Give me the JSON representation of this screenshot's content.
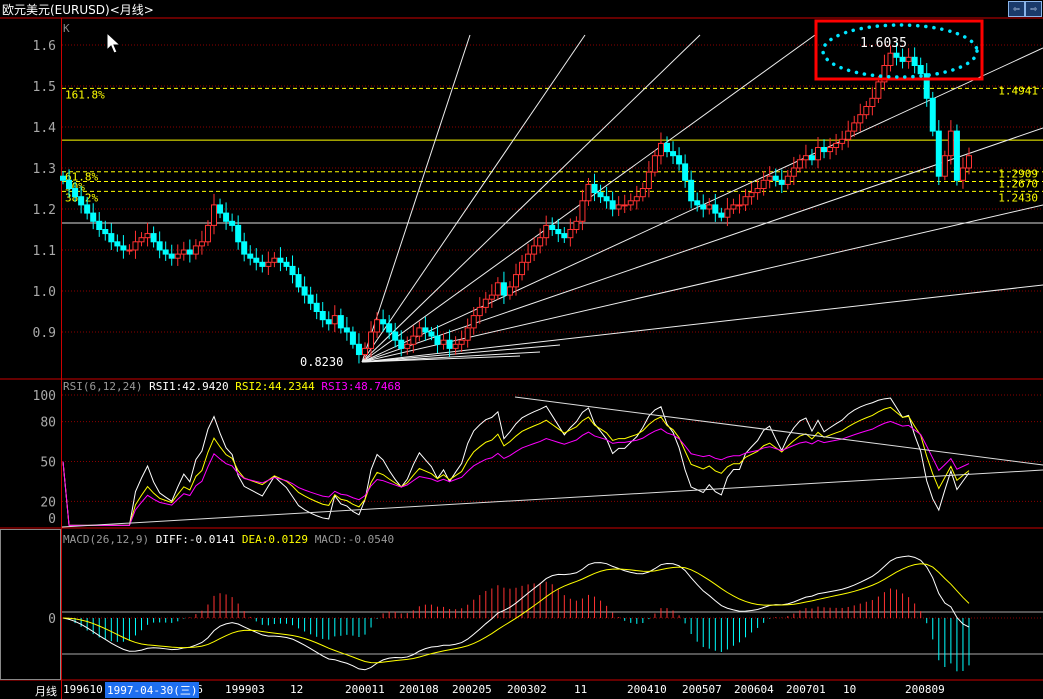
{
  "window": {
    "title": "欧元美元(EURUSD)<月线>",
    "nav_left": "⇦",
    "nav_right": "⇨"
  },
  "colors": {
    "up": "#ff3232",
    "down": "#00ffff",
    "fib": "#ffff00",
    "rsi1": "#ffffff",
    "rsi2": "#ffff00",
    "rsi3": "#ff00ff",
    "grid": "#8b0000",
    "annotation_box": "#ff0000",
    "annotation_ellipse": "#00e5ff"
  },
  "main_panel": {
    "label": "K",
    "low_label": "0.8230",
    "high_label": "1.6035",
    "fib_levels": [
      {
        "pct": "161.8%",
        "price": 1.4941,
        "price_label": "1.4941"
      },
      {
        "pct": "61.8%",
        "price": 1.2909,
        "price_label": "1.2909"
      },
      {
        "pct": "50%",
        "price": 1.267,
        "price_label": "1.2670"
      },
      {
        "pct": "38.2%",
        "price": 1.243,
        "price_label": "1.2430"
      }
    ]
  },
  "rsi_panel": {
    "name": "RSI(6,12,24)",
    "rsi1": "RSI1:42.9420",
    "rsi2": "RSI2:44.2344",
    "rsi3": "RSI3:48.7468"
  },
  "macd_panel": {
    "name": "MACD(26,12,9)",
    "diff": "DIFF:-0.0141",
    "dea": "DEA:0.0129",
    "macd": "MACD:-0.0540"
  },
  "x_axis": {
    "period_label": "月线",
    "selected_date": "1997-04-30(三)",
    "ticks": [
      "199610",
      "806",
      "199903",
      "12",
      "200011",
      "200108",
      "200205",
      "200302",
      "11",
      "200410",
      "200507",
      "200604",
      "200701",
      "10",
      "200809"
    ]
  },
  "chart_data": {
    "type": "candlestick",
    "start_month": "1996-10",
    "interval": "monthly",
    "y_ticks": [
      0.9,
      1.0,
      1.1,
      1.2,
      1.3,
      1.4,
      1.5,
      1.6
    ],
    "ylim": [
      0.82,
      1.63
    ],
    "horizontal_lines": [
      1.368,
      1.166
    ],
    "low": {
      "month": "2000-10",
      "value": 0.823
    },
    "high": {
      "month": "2008-07",
      "value": 1.6035
    },
    "close": [
      1.27,
      1.25,
      1.23,
      1.21,
      1.19,
      1.17,
      1.15,
      1.14,
      1.12,
      1.11,
      1.1,
      1.1,
      1.12,
      1.13,
      1.14,
      1.12,
      1.1,
      1.09,
      1.08,
      1.09,
      1.1,
      1.09,
      1.11,
      1.12,
      1.16,
      1.21,
      1.19,
      1.17,
      1.16,
      1.12,
      1.09,
      1.08,
      1.07,
      1.06,
      1.07,
      1.08,
      1.07,
      1.06,
      1.04,
      1.01,
      0.99,
      0.97,
      0.95,
      0.93,
      0.92,
      0.94,
      0.91,
      0.9,
      0.87,
      0.845,
      0.86,
      0.9,
      0.93,
      0.92,
      0.9,
      0.88,
      0.86,
      0.87,
      0.89,
      0.91,
      0.9,
      0.89,
      0.87,
      0.88,
      0.86,
      0.87,
      0.88,
      0.91,
      0.94,
      0.96,
      0.98,
      0.99,
      1.02,
      0.99,
      1.01,
      1.04,
      1.07,
      1.09,
      1.11,
      1.13,
      1.16,
      1.15,
      1.14,
      1.13,
      1.15,
      1.17,
      1.22,
      1.26,
      1.24,
      1.23,
      1.22,
      1.2,
      1.21,
      1.21,
      1.22,
      1.23,
      1.25,
      1.29,
      1.33,
      1.36,
      1.34,
      1.33,
      1.31,
      1.27,
      1.22,
      1.21,
      1.2,
      1.21,
      1.19,
      1.18,
      1.2,
      1.21,
      1.21,
      1.23,
      1.24,
      1.25,
      1.27,
      1.28,
      1.27,
      1.26,
      1.28,
      1.3,
      1.32,
      1.33,
      1.32,
      1.35,
      1.34,
      1.35,
      1.36,
      1.37,
      1.39,
      1.41,
      1.43,
      1.45,
      1.47,
      1.51,
      1.55,
      1.58,
      1.57,
      1.56,
      1.57,
      1.55,
      1.53,
      1.47,
      1.39,
      1.28,
      1.33,
      1.39,
      1.27,
      1.3,
      1.33
    ],
    "rsi": {
      "periods": [
        6,
        12,
        24
      ],
      "y_ticks": [
        0,
        20,
        50,
        80,
        100
      ],
      "ylim": [
        0,
        100
      ]
    },
    "macd": {
      "params": [
        26,
        12,
        9
      ],
      "y_ticks": [
        0
      ]
    }
  }
}
